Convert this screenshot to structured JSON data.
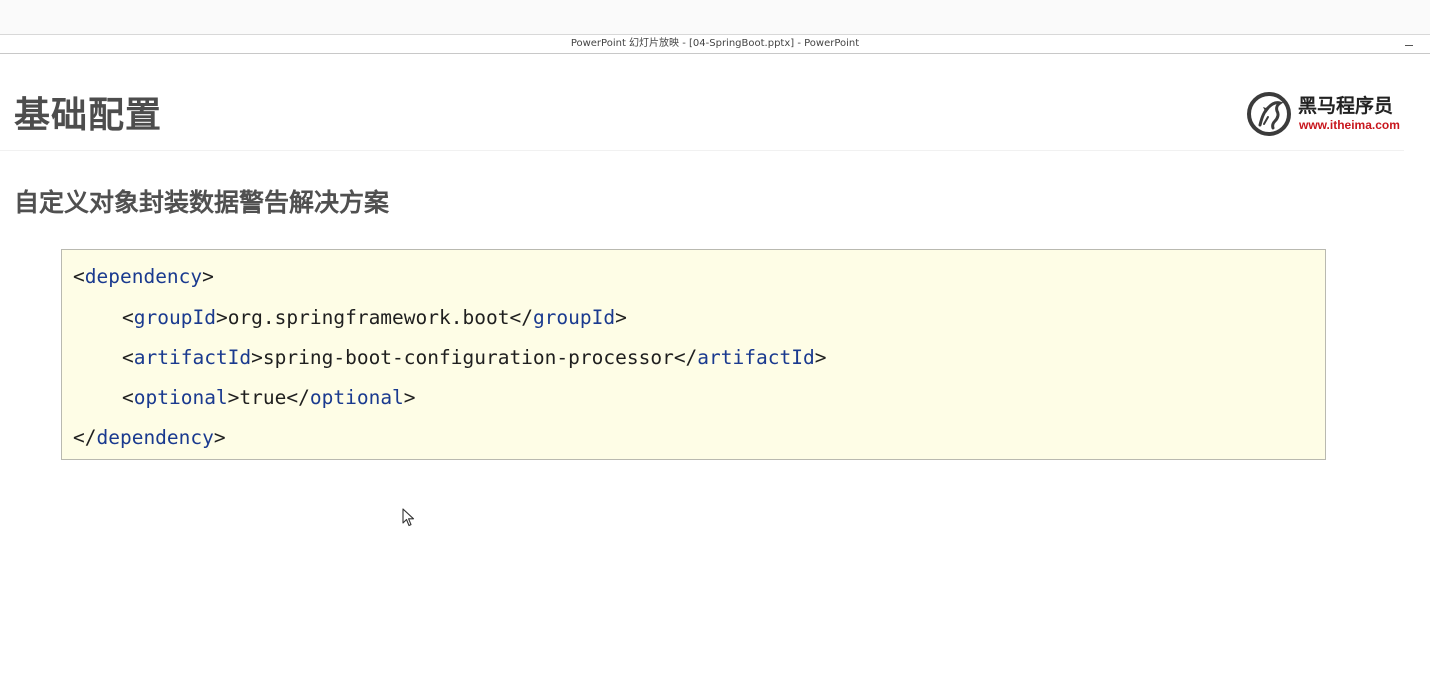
{
  "window": {
    "title": "PowerPoint 幻灯片放映 - [04-SpringBoot.pptx] - PowerPoint"
  },
  "slide": {
    "title": "基础配置",
    "subtitle": "自定义对象封装数据警告解决方案",
    "logo": {
      "name": "黑马程序员",
      "url": "www.itheima.com",
      "icon": "horse-logo-icon",
      "url_color": "#c8161d"
    },
    "code": {
      "background": "#fefde6",
      "tag_color": "#1a3a8f",
      "lines": [
        {
          "indent": 0,
          "open": "dependency",
          "text": "",
          "close": ""
        },
        {
          "indent": 1,
          "open": "groupId",
          "text": "org.springframework.boot",
          "close": "groupId"
        },
        {
          "indent": 1,
          "open": "artifactId",
          "text": "spring-boot-configuration-processor",
          "close": "artifactId"
        },
        {
          "indent": 1,
          "open": "optional",
          "text": "true",
          "close": "optional"
        },
        {
          "indent": 0,
          "open": "",
          "text": "",
          "close": "dependency"
        }
      ]
    }
  }
}
